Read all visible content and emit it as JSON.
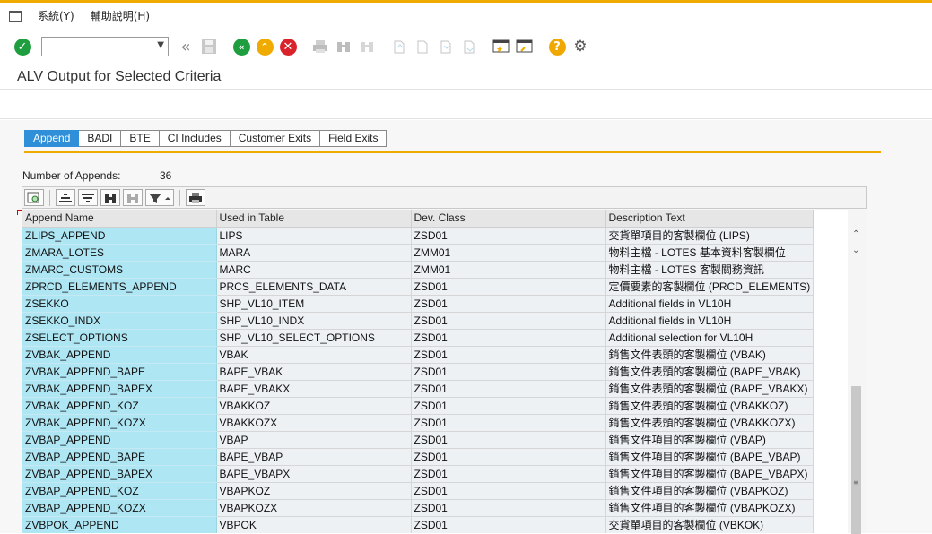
{
  "menu": {
    "system": "系統(Y)",
    "help": "輔助說明(H)"
  },
  "toolbar": {
    "command_value": "",
    "icons": [
      "check-icon",
      "command-dropdown-icon",
      "double-left-icon",
      "save-icon",
      "back-icon",
      "exit-icon",
      "cancel-icon",
      "print-icon",
      "find-icon",
      "find-next-icon",
      "first-page-icon",
      "previous-page-icon",
      "next-page-icon",
      "last-page-icon",
      "create-session-icon",
      "shortcut-icon",
      "help-icon",
      "settings-icon"
    ]
  },
  "title": "ALV Output for Selected Criteria",
  "tabs": [
    "Append",
    "BADI",
    "BTE",
    "CI Includes",
    "Customer Exits",
    "Field Exits"
  ],
  "count": {
    "label": "Number of Appends:",
    "value": "36"
  },
  "alv_toolbar_icons": [
    "details-icon",
    "sort-ascending-icon",
    "sort-descending-icon",
    "find-icon",
    "find-next-icon",
    "filter-icon",
    "print-icon"
  ],
  "columns": [
    "Append Name",
    "Used in Table",
    "Dev. Class",
    "Description Text"
  ],
  "rows": [
    [
      "ZLIPS_APPEND",
      "LIPS",
      "ZSD01",
      "交貨單項目的客製欄位 (LIPS)"
    ],
    [
      "ZMARA_LOTES",
      "MARA",
      "ZMM01",
      "物料主檔 - LOTES 基本資料客製欄位"
    ],
    [
      "ZMARC_CUSTOMS",
      "MARC",
      "ZMM01",
      "物料主檔 - LOTES 客製關務資訊"
    ],
    [
      "ZPRCD_ELEMENTS_APPEND",
      "PRCS_ELEMENTS_DATA",
      "ZSD01",
      "定價要素的客製欄位 (PRCD_ELEMENTS)"
    ],
    [
      "ZSEKKO",
      "SHP_VL10_ITEM",
      "ZSD01",
      "Additional fields in VL10H"
    ],
    [
      "ZSEKKO_INDX",
      "SHP_VL10_INDX",
      "ZSD01",
      "Additional fields in VL10H"
    ],
    [
      "ZSELECT_OPTIONS",
      "SHP_VL10_SELECT_OPTIONS",
      "ZSD01",
      "Additional selection for VL10H"
    ],
    [
      "ZVBAK_APPEND",
      "VBAK",
      "ZSD01",
      "銷售文件表頭的客製欄位 (VBAK)"
    ],
    [
      "ZVBAK_APPEND_BAPE",
      "BAPE_VBAK",
      "ZSD01",
      "銷售文件表頭的客製欄位 (BAPE_VBAK)"
    ],
    [
      "ZVBAK_APPEND_BAPEX",
      "BAPE_VBAKX",
      "ZSD01",
      "銷售文件表頭的客製欄位 (BAPE_VBAKX)"
    ],
    [
      "ZVBAK_APPEND_KOZ",
      "VBAKKOZ",
      "ZSD01",
      "銷售文件表頭的客製欄位 (VBAKKOZ)"
    ],
    [
      "ZVBAK_APPEND_KOZX",
      "VBAKKOZX",
      "ZSD01",
      "銷售文件表頭的客製欄位 (VBAKKOZX)"
    ],
    [
      "ZVBAP_APPEND",
      "VBAP",
      "ZSD01",
      "銷售文件項目的客製欄位 (VBAP)"
    ],
    [
      "ZVBAP_APPEND_BAPE",
      "BAPE_VBAP",
      "ZSD01",
      "銷售文件項目的客製欄位 (BAPE_VBAP)"
    ],
    [
      "ZVBAP_APPEND_BAPEX",
      "BAPE_VBAPX",
      "ZSD01",
      "銷售文件項目的客製欄位 (BAPE_VBAPX)"
    ],
    [
      "ZVBAP_APPEND_KOZ",
      "VBAPKOZ",
      "ZSD01",
      "銷售文件項目的客製欄位 (VBAPKOZ)"
    ],
    [
      "ZVBAP_APPEND_KOZX",
      "VBAPKOZX",
      "ZSD01",
      "銷售文件項目的客製欄位 (VBAPKOZX)"
    ],
    [
      "ZVBPOK_APPEND",
      "VBPOK",
      "ZSD01",
      "交貨單項目的客製欄位 (VBKOK)"
    ]
  ],
  "colors": {
    "accent": "#f0ab00",
    "tab_active": "#2f8fd8",
    "key_cell": "#aee6f4",
    "row_cell": "#edf1f4",
    "check": "#1e9e3e",
    "nav": "#f0ab00",
    "cancel": "#d9222a",
    "help": "#f0a800"
  }
}
